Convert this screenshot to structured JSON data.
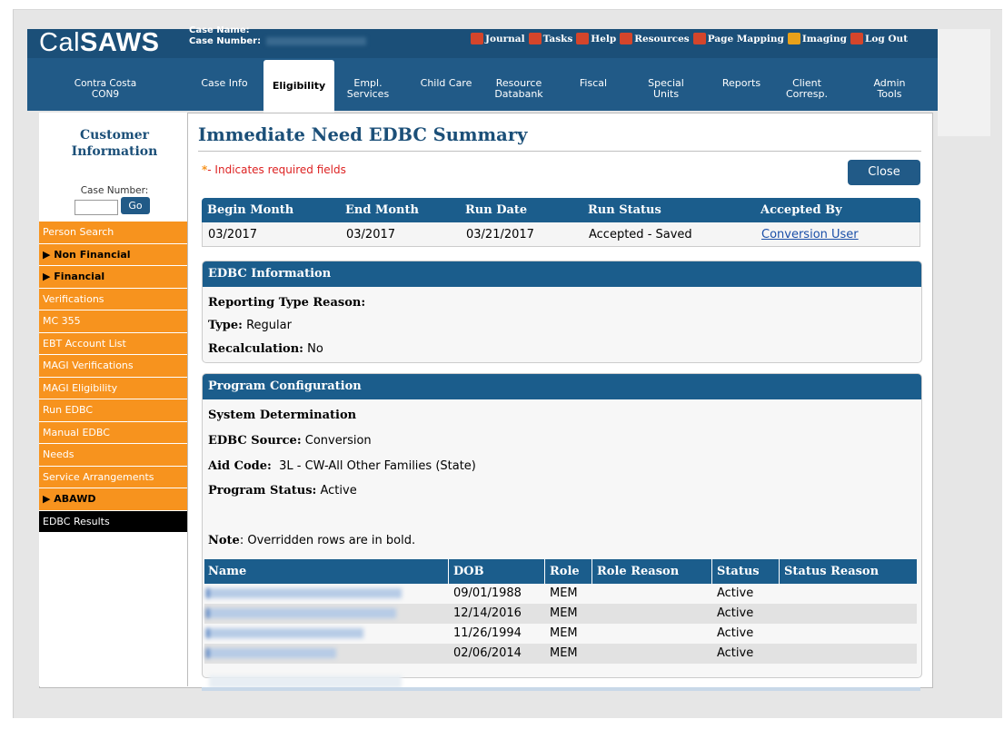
{
  "app": {
    "logo_pre": "Cal",
    "logo_bold": "SAWS",
    "case_name_label": "Case Name:",
    "case_number_label": "Case Number:"
  },
  "toplinks": [
    {
      "label": "Journal",
      "icon": "journal-icon",
      "color": "#d4452b"
    },
    {
      "label": "Tasks",
      "icon": "tasks-icon",
      "color": "#d4452b"
    },
    {
      "label": "Help",
      "icon": "help-icon",
      "color": "#d4452b"
    },
    {
      "label": "Resources",
      "icon": "resources-icon",
      "color": "#d4452b"
    },
    {
      "label": "Page Mapping",
      "icon": "page-mapping-icon",
      "color": "#d4452b"
    },
    {
      "label": "Imaging",
      "icon": "imaging-icon",
      "color": "#e8a11a"
    },
    {
      "label": "Log Out",
      "icon": "logout-icon",
      "color": "#d4452b"
    }
  ],
  "county": {
    "line1": "Contra Costa",
    "line2": "CON9"
  },
  "tabs": [
    {
      "line1": "Case Info",
      "line2": ""
    },
    {
      "line1": "Eligibility",
      "line2": ""
    },
    {
      "line1": "Empl.",
      "line2": "Services"
    },
    {
      "line1": "Child Care",
      "line2": ""
    },
    {
      "line1": "Resource",
      "line2": "Databank"
    },
    {
      "line1": "Fiscal",
      "line2": ""
    },
    {
      "line1": "Special",
      "line2": "Units"
    },
    {
      "line1": "Reports",
      "line2": ""
    },
    {
      "line1": "Client",
      "line2": "Corresp."
    },
    {
      "line1": "Admin",
      "line2": "Tools"
    }
  ],
  "sidebar": {
    "title_line1": "Customer",
    "title_line2": "Information",
    "case_number_label": "Case Number:",
    "go_label": "Go",
    "items": [
      {
        "label": "Person Search",
        "type": "link"
      },
      {
        "label": "▶ Non Financial",
        "type": "hdr"
      },
      {
        "label": "▶ Financial",
        "type": "hdr"
      },
      {
        "label": "Verifications",
        "type": "link"
      },
      {
        "label": "MC 355",
        "type": "link"
      },
      {
        "label": "EBT Account List",
        "type": "link"
      },
      {
        "label": "MAGI Verifications",
        "type": "link"
      },
      {
        "label": "MAGI Eligibility",
        "type": "link"
      },
      {
        "label": "Run EDBC",
        "type": "link"
      },
      {
        "label": "Manual EDBC",
        "type": "link"
      },
      {
        "label": "Needs",
        "type": "link"
      },
      {
        "label": "Service Arrangements",
        "type": "link"
      },
      {
        "label": "▶ ABAWD",
        "type": "hdr"
      },
      {
        "label": "EDBC Results",
        "type": "sel"
      }
    ]
  },
  "page": {
    "title": "Immediate Need EDBC Summary",
    "required_star": "*",
    "required_text": "- Indicates required fields",
    "close_label": "Close"
  },
  "summary": {
    "headers": [
      "Begin Month",
      "End Month",
      "Run Date",
      "Run Status",
      "Accepted By"
    ],
    "row": [
      "03/2017",
      "03/2017",
      "03/21/2017",
      "Accepted - Saved",
      "Conversion User"
    ]
  },
  "edbc_info": {
    "title": "EDBC Information",
    "reporting_label": "Reporting Type Reason:",
    "reporting_value": "",
    "type_label": "Type:",
    "type_value": "Regular",
    "recalc_label": "Recalculation:",
    "recalc_value": "No"
  },
  "program": {
    "title": "Program Configuration",
    "system_det": "System Determination",
    "source_label": "EDBC Source:",
    "source_value": "Conversion",
    "aid_label": "Aid Code:",
    "aid_value": "3L - CW-All Other Families (State)",
    "status_label": "Program Status:",
    "status_value": "Active",
    "note_label": "Note",
    "note_text": ": Overridden rows are in bold."
  },
  "members": {
    "headers": [
      "Name",
      "DOB",
      "Role",
      "Role Reason",
      "Status",
      "Status Reason"
    ],
    "rows": [
      {
        "dob": "09/01/1988",
        "role": "MEM",
        "role_reason": "",
        "status": "Active",
        "status_reason": ""
      },
      {
        "dob": "12/14/2016",
        "role": "MEM",
        "role_reason": "",
        "status": "Active",
        "status_reason": ""
      },
      {
        "dob": "11/26/1994",
        "role": "MEM",
        "role_reason": "",
        "status": "Active",
        "status_reason": ""
      },
      {
        "dob": "02/06/2014",
        "role": "MEM",
        "role_reason": "",
        "status": "Active",
        "status_reason": ""
      }
    ]
  }
}
